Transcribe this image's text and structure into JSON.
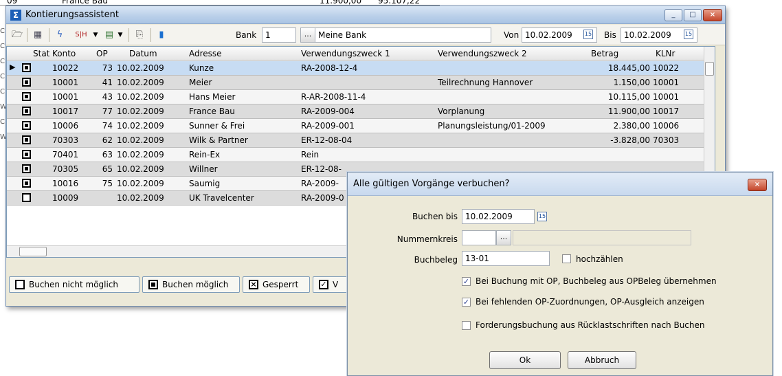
{
  "bg": {
    "row_left": "09",
    "row_name": "France Bau",
    "row_amount": "11.900,00",
    "row_amount2": "95.107,22",
    "edge_letters": [
      "C",
      "C",
      "C",
      "C",
      "C",
      "W",
      "C",
      "W"
    ]
  },
  "window": {
    "title": "Kontierungsassistent",
    "min_label": "_",
    "max_label": "□",
    "close_label": "×"
  },
  "toolbar": {
    "bank_label": "Bank",
    "bank_value": "1",
    "bank_btn": "...",
    "bank_name": "Meine Bank",
    "von_label": "Von",
    "von_value": "10.02.2009",
    "bis_label": "Bis",
    "bis_value": "10.02.2009",
    "cal_label": "15"
  },
  "grid": {
    "headers": [
      "Stat",
      "Konto",
      "OP",
      "Datum",
      "Adresse",
      "Verwendungszweck 1",
      "Verwendungszweck 2",
      "Betrag",
      "KLNr"
    ],
    "rows": [
      {
        "konto": "10022",
        "op": "73",
        "datum": "10.02.2009",
        "adresse": "Kunze",
        "vz1": "RA-2008-12-4",
        "vz2": "",
        "betrag": "18.445,00",
        "klnr": "10022",
        "stat": "filled"
      },
      {
        "konto": "10001",
        "op": "41",
        "datum": "10.02.2009",
        "adresse": "Meier",
        "vz1": "",
        "vz2": "Teilrechnung Hannover",
        "betrag": "1.150,00",
        "klnr": "10001",
        "stat": "filled"
      },
      {
        "konto": "10001",
        "op": "43",
        "datum": "10.02.2009",
        "adresse": "Hans Meier",
        "vz1": "R-AR-2008-11-4",
        "vz2": "",
        "betrag": "10.115,00",
        "klnr": "10001",
        "stat": "filled"
      },
      {
        "konto": "10017",
        "op": "77",
        "datum": "10.02.2009",
        "adresse": "France Bau",
        "vz1": "RA-2009-004",
        "vz2": "Vorplanung",
        "betrag": "11.900,00",
        "klnr": "10017",
        "stat": "filled"
      },
      {
        "konto": "10006",
        "op": "74",
        "datum": "10.02.2009",
        "adresse": "Sunner & Frei",
        "vz1": "RA-2009-001",
        "vz2": "Planungsleistung/01-2009",
        "betrag": "2.380,00",
        "klnr": "10006",
        "stat": "filled"
      },
      {
        "konto": "70303",
        "op": "62",
        "datum": "10.02.2009",
        "adresse": "Wilk & Partner",
        "vz1": "ER-12-08-04",
        "vz2": "",
        "betrag": "-3.828,00",
        "klnr": "70303",
        "stat": "filled"
      },
      {
        "konto": "70401",
        "op": "63",
        "datum": "10.02.2009",
        "adresse": "Rein-Ex",
        "vz1": "Rein",
        "vz2": "",
        "betrag": "",
        "klnr": "",
        "stat": "filled"
      },
      {
        "konto": "70305",
        "op": "65",
        "datum": "10.02.2009",
        "adresse": "Willner",
        "vz1": "ER-12-08-",
        "vz2": "",
        "betrag": "",
        "klnr": "",
        "stat": "filled"
      },
      {
        "konto": "10016",
        "op": "75",
        "datum": "10.02.2009",
        "adresse": "Saumig",
        "vz1": "RA-2009-",
        "vz2": "",
        "betrag": "",
        "klnr": "",
        "stat": "filled"
      },
      {
        "konto": "10009",
        "op": "",
        "datum": "10.02.2009",
        "adresse": "UK Travelcenter",
        "vz1": "RA-2009-0",
        "vz2": "",
        "betrag": "",
        "klnr": "",
        "stat": "empty"
      }
    ]
  },
  "legend": {
    "nicht": "Buchen nicht möglich",
    "moeglich": "Buchen möglich",
    "gesperrt": "Gesperrt",
    "v": "V"
  },
  "dialog": {
    "title": "Alle gültigen Vorgänge verbuchen?",
    "close_label": "×",
    "buchen_bis_label": "Buchen bis",
    "buchen_bis_value": "10.02.2009",
    "nummernkreis_label": "Nummernkreis",
    "nummernkreis_btn": "...",
    "buchbeleg_label": "Buchbeleg",
    "buchbeleg_value": "13-01",
    "hochzaehlen": "hochzählen",
    "opt1": "Bei Buchung mit OP, Buchbeleg aus OPBeleg übernehmen",
    "opt2": "Bei fehlenden OP-Zuordnungen, OP-Ausgleich anzeigen",
    "opt3": "Forderungsbuchung aus Rücklastschriften nach Buchen",
    "ok": "Ok",
    "abbruch": "Abbruch",
    "check_mark": "✓"
  },
  "colors": {
    "selected_row": "#c7dcf3",
    "title_bar": "#b9cfe9",
    "close_button": "#c4452a"
  }
}
